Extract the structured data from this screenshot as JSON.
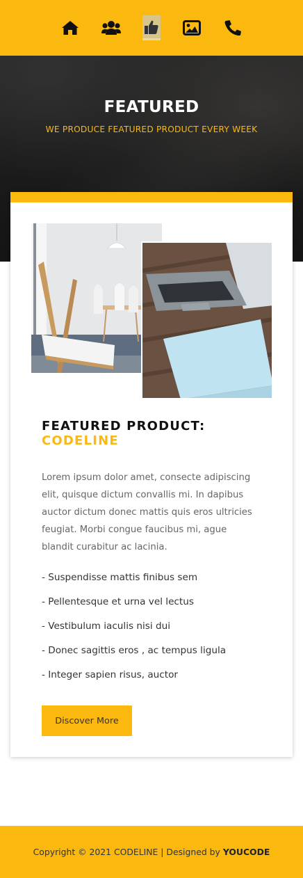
{
  "nav": {
    "items": [
      {
        "icon": "home-icon",
        "active": false
      },
      {
        "icon": "users-icon",
        "active": false
      },
      {
        "icon": "thumbs-up-icon",
        "active": true
      },
      {
        "icon": "image-icon",
        "active": false
      },
      {
        "icon": "phone-icon",
        "active": false
      }
    ]
  },
  "hero": {
    "title": "FEATURED",
    "subtitle": "WE PRODUCE FEATURED PRODUCT EVERY WEEK"
  },
  "product": {
    "heading": "FEATURED PRODUCT:",
    "name": "CODELINE",
    "description": "Lorem ipsum dolor amet, consecte adipiscing elit, quisque dictum convallis mi. In dapibus auctor dictum donec mattis quis eros ultricies feugiat. Morbi congue faucibus mi, ague blandit curabitur ac lacinia.",
    "features": [
      "- Suspendisse mattis finibus sem",
      "- Pellentesque et urna vel lectus",
      "- Vestibulum iaculis nisi dui",
      "- Donec sagittis eros , ac tempus ligula",
      "- Integer sapien risus, auctor"
    ],
    "button_label": "Discover More"
  },
  "footer": {
    "copyright": "Copyright © 2021 CODELINE | Designed by",
    "designer": "YOUCODE"
  },
  "colors": {
    "accent": "#fbb80f",
    "text_dark": "#111111",
    "text_muted": "#666666"
  }
}
